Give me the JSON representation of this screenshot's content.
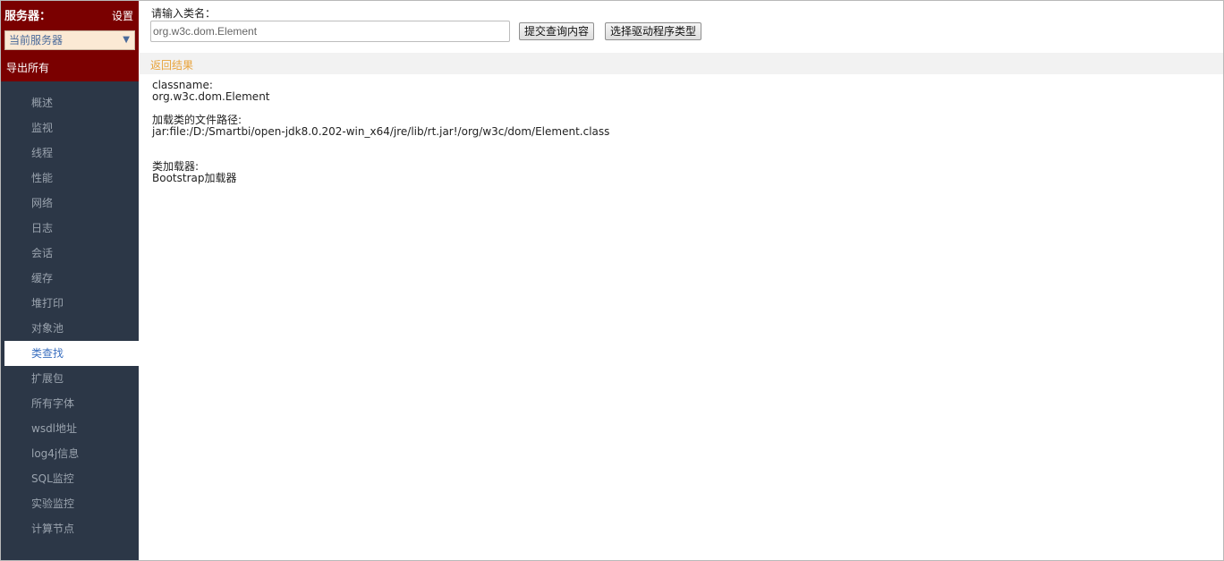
{
  "sidebar": {
    "title": "服务器：",
    "settings_label": "设置",
    "server_select": {
      "value": "当前服务器",
      "arrow": "▼"
    },
    "export_label": "导出所有",
    "nav_items": [
      {
        "label": "概述",
        "active": false
      },
      {
        "label": "监视",
        "active": false
      },
      {
        "label": "线程",
        "active": false
      },
      {
        "label": "性能",
        "active": false
      },
      {
        "label": "网络",
        "active": false
      },
      {
        "label": "日志",
        "active": false
      },
      {
        "label": "会话",
        "active": false
      },
      {
        "label": "缓存",
        "active": false
      },
      {
        "label": "堆打印",
        "active": false
      },
      {
        "label": "对象池",
        "active": false
      },
      {
        "label": "类查找",
        "active": true
      },
      {
        "label": "扩展包",
        "active": false
      },
      {
        "label": "所有字体",
        "active": false
      },
      {
        "label": "wsdl地址",
        "active": false
      },
      {
        "label": "log4j信息",
        "active": false
      },
      {
        "label": "SQL监控",
        "active": false
      },
      {
        "label": "实验监控",
        "active": false
      },
      {
        "label": "计算节点",
        "active": false
      }
    ]
  },
  "query": {
    "label": "请输入类名：",
    "input_value": "org.w3c.dom.Element",
    "submit_label": "提交查询内容",
    "driver_label": "选择驱动程序类型"
  },
  "result": {
    "title": "返回结果",
    "classname_label": "classname:",
    "classname_value": "org.w3c.dom.Element",
    "path_label": "加载类的文件路径:",
    "path_value": "jar:file:/D:/Smartbi/open-jdk8.0.202-win_x64/jre/lib/rt.jar!/org/w3c/dom/Element.class",
    "loader_label": "类加载器:",
    "loader_value": "Bootstrap加载器"
  },
  "colors": {
    "sidebar_header": "#7a0000",
    "sidebar_bg": "#2c3747",
    "active_nav_text": "#3a6fbf",
    "result_title": "#e8a33a"
  }
}
